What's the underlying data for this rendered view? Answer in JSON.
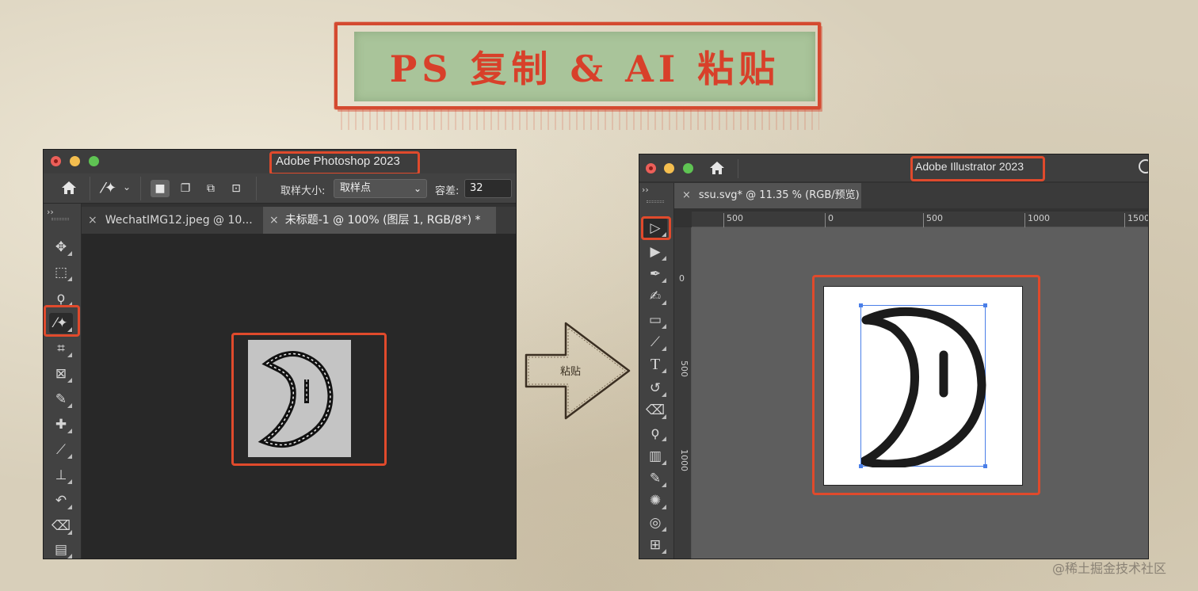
{
  "banner": {
    "title": "PS 复制 & AI 粘贴"
  },
  "photoshop": {
    "window_title": "Adobe Photoshop 2023",
    "options": {
      "sample_size_label": "取样大小:",
      "sample_size_value": "取样点",
      "tolerance_label": "容差:",
      "tolerance_value": "32"
    },
    "tabs": [
      {
        "close": "×",
        "label": "WechatIMG12.jpeg @ 10..."
      },
      {
        "close": "×",
        "label": "未标题-1 @ 100% (图层 1, RGB/8*) *"
      }
    ],
    "panel_toggle": "››",
    "tools": [
      "move",
      "marquee",
      "lasso",
      "magic-wand",
      "crop",
      "frame",
      "eyedropper",
      "healing-brush",
      "brush",
      "clone-stamp",
      "history-brush",
      "eraser",
      "gradient"
    ]
  },
  "arrow": {
    "label": "粘贴"
  },
  "illustrator": {
    "window_title": "Adobe Illustrator 2023",
    "tab": {
      "close": "×",
      "label": "ssu.svg* @ 11.35 % (RGB/预览)"
    },
    "panel_toggle": "››",
    "ruler_h": [
      "500",
      "0",
      "500",
      "1000",
      "1500"
    ],
    "ruler_v": [
      "0",
      "500",
      "1000"
    ],
    "tools": [
      "selection",
      "direct-selection",
      "pen",
      "curvature",
      "rectangle",
      "paintbrush",
      "type",
      "rotate",
      "eraser",
      "lasso",
      "gradient",
      "eyedropper",
      "symbol-sprayer",
      "shape-builder",
      "artboard"
    ]
  },
  "watermark": "@稀土掘金技术社区",
  "colors": {
    "highlight": "#e04a2c",
    "banner_bg": "#a9c49a",
    "banner_text": "#d8402a",
    "selection": "#4a7fe8"
  }
}
